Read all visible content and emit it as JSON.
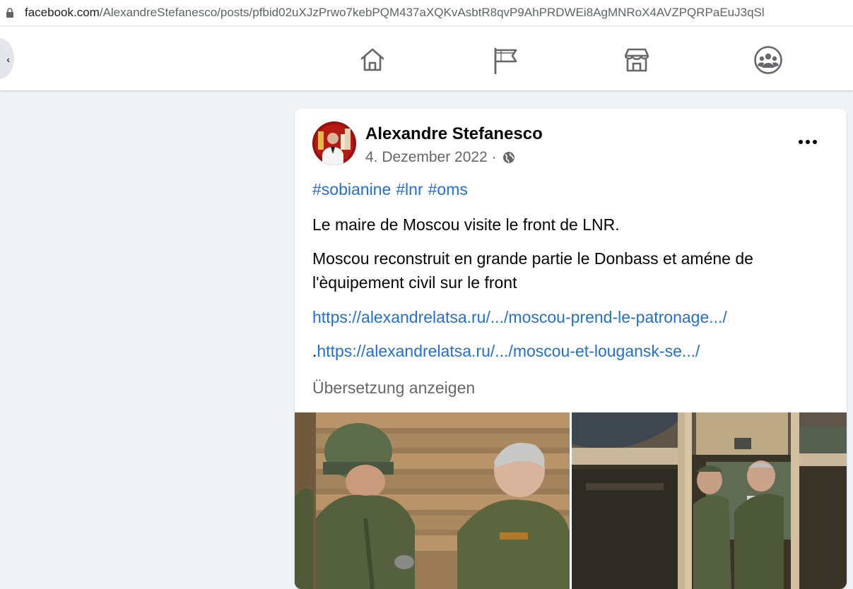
{
  "browser": {
    "url_host": "facebook.com",
    "url_path": "/AlexandreStefanesco/posts/pfbid02uXJzPrwo7kebPQM437aXQKvAsbtR8qvP9AhPRDWEi8AgMNRoX4AVZPQRPaEuJ3qSl"
  },
  "nav": {
    "icons": [
      "home-icon",
      "pages-flag-icon",
      "marketplace-icon",
      "groups-icon"
    ]
  },
  "post": {
    "author": "Alexandre Stefanesco",
    "date": "4. Dezember 2022",
    "date_separator": "·",
    "hashtags": [
      "#sobianine",
      "#lnr",
      "#oms"
    ],
    "line1": "Le maire de Moscou visite le front de LNR.",
    "line2": "Moscou reconstruit en grande partie le Donbass et améne de l'èquipement civil sur le front",
    "link1": "https://alexandrelatsa.ru/.../moscou-prend-le-patronage.../",
    "link2_prefix": ".",
    "link2": "https://alexandrelatsa.ru/.../moscou-et-lougansk-se.../",
    "translate": "Übersetzung anzeigen"
  },
  "colors": {
    "link": "#216fdb",
    "muted": "#65676b",
    "background": "#f0f2f5"
  }
}
